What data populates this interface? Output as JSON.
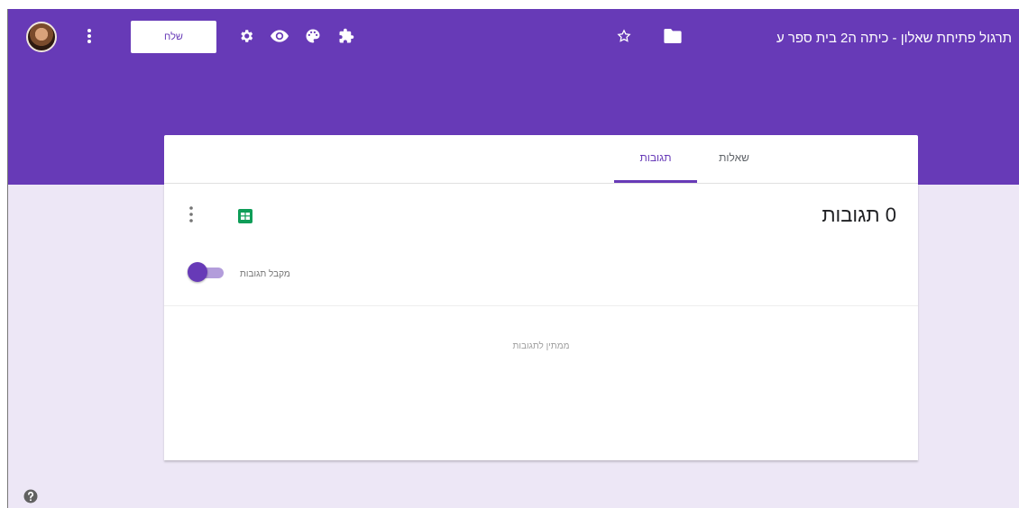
{
  "header": {
    "title": "תרגול פתיחת שאלון - כיתה ה2 בית ספר ע",
    "send_label": "שלח",
    "accent": "#673ab7"
  },
  "icons": [
    "avatar",
    "more-vert-icon",
    "gear-icon",
    "eye-icon",
    "palette-icon",
    "puzzle-icon",
    "star-icon",
    "folder-icon",
    "sheets-icon",
    "help-icon"
  ],
  "tabs": [
    {
      "label": "שאלות",
      "active": false
    },
    {
      "label": "תגובות",
      "active": true
    }
  ],
  "responses": {
    "count_text": "0 תגובות",
    "accepting_label": "מקבל תגובות",
    "accepting": true,
    "empty_message": "ממתין לתגובות"
  }
}
